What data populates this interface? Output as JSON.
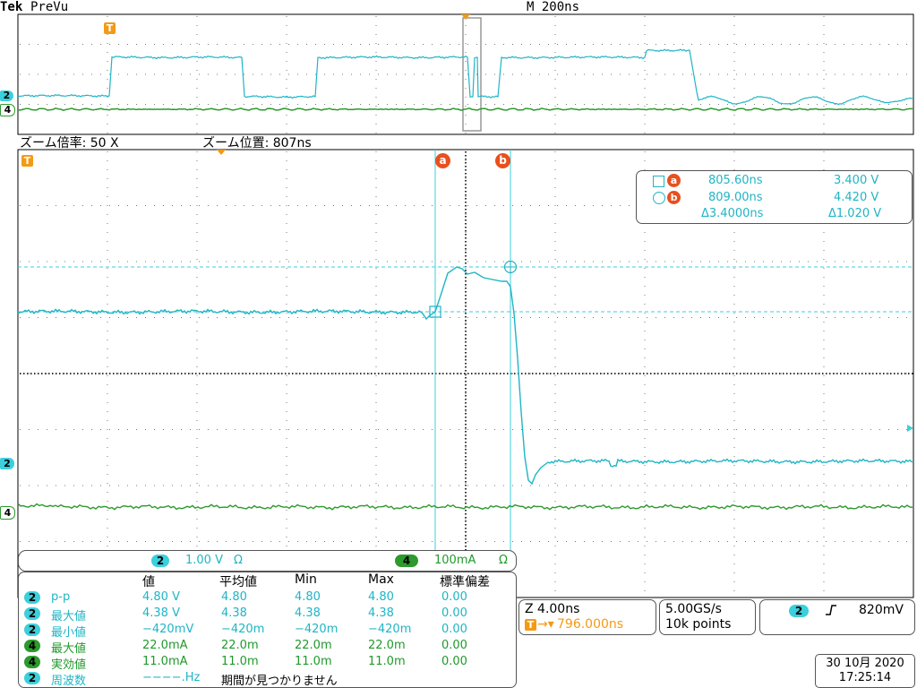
{
  "header": {
    "brand": "Tek",
    "mode": "PreVu",
    "timebase": "M 200ns"
  },
  "zoom_bar": {
    "zoom_factor_label": "ズーム倍率: 50 X",
    "zoom_position_label": "ズーム位置: 807ns"
  },
  "markers": {
    "trigger": "T",
    "ch2": "2",
    "ch4": "4",
    "cursor_a": "a",
    "cursor_b": "b"
  },
  "cursor_readout": {
    "a_time": "805.60ns",
    "a_value": "3.400 V",
    "b_time": "809.00ns",
    "b_value": "4.420 V",
    "delta_time": "Δ3.4000ns",
    "delta_value": "Δ1.020 V"
  },
  "channel_settings": {
    "ch2_label": "2",
    "ch2_scale": "1.00 V",
    "ch2_coupling": "Ω",
    "ch4_label": "4",
    "ch4_scale": "100mA",
    "ch4_coupling": "Ω"
  },
  "measurements": {
    "headers": [
      "値",
      "平均値",
      "Min",
      "Max",
      "標準偏差"
    ],
    "rows": [
      {
        "ch": "2",
        "name": "p-p",
        "value": "4.80 V",
        "mean": "4.80",
        "min": "4.80",
        "max": "4.80",
        "std": "0.00"
      },
      {
        "ch": "2",
        "name": "最大値",
        "value": "4.38 V",
        "mean": "4.38",
        "min": "4.38",
        "max": "4.38",
        "std": "0.00"
      },
      {
        "ch": "2",
        "name": "最小値",
        "value": "−420mV",
        "mean": "−420m",
        "min": "−420m",
        "max": "−420m",
        "std": "0.00"
      },
      {
        "ch": "4",
        "name": "最大値",
        "value": "22.0mA",
        "mean": "22.0m",
        "min": "22.0m",
        "max": "22.0m",
        "std": "0.00"
      },
      {
        "ch": "4",
        "name": "実効値",
        "value": "11.0mA",
        "mean": "11.0m",
        "min": "11.0m",
        "max": "11.0m",
        "std": "0.00"
      },
      {
        "ch": "2",
        "name": "周波数",
        "value": "−−−−.Hz",
        "note": "期間が見つかりません"
      }
    ]
  },
  "horizontal": {
    "zoom_scale": "Z 4.00ns",
    "trigger_pos": "796.000ns"
  },
  "acquisition": {
    "sample_rate": "5.00GS/s",
    "record_length": "10k points"
  },
  "trigger": {
    "source": "2",
    "slope": "rising",
    "level": "820mV"
  },
  "datetime": {
    "date": "30 10月 2020",
    "time": "17:25:14"
  },
  "colors": {
    "ch2": "#3ccfdc",
    "ch4": "#2c9a2c",
    "trigger": "#f39a16",
    "cursor_badge": "#e8501e"
  }
}
